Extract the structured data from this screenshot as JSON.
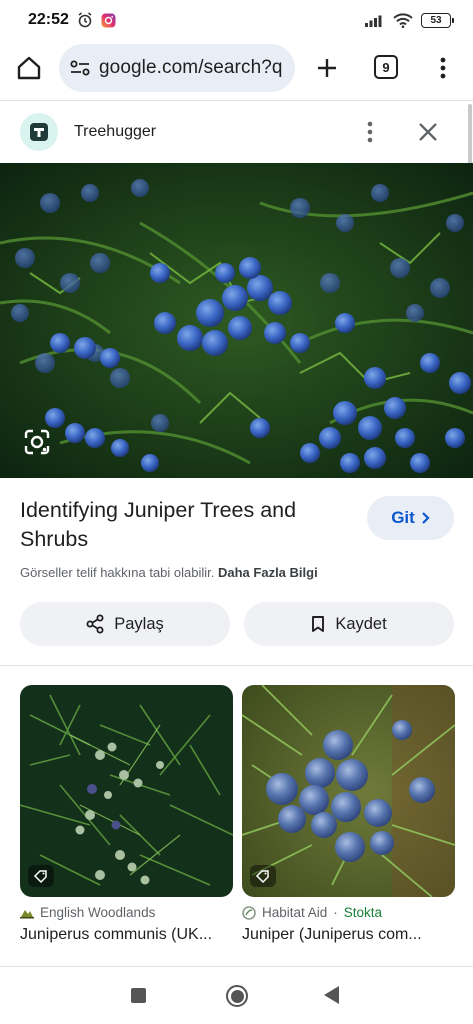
{
  "status_bar": {
    "time": "22:52",
    "battery": "53",
    "icons": [
      "alarm-icon",
      "instagram-icon",
      "signal-icon",
      "wifi-icon",
      "battery-icon"
    ]
  },
  "toolbar": {
    "url": "google.com/search?q",
    "tab_count": "9",
    "icons": [
      "home-icon",
      "site-info-icon",
      "plus-icon",
      "tabs-icon",
      "more-vert-icon"
    ]
  },
  "source": {
    "site_name": "Treehugger"
  },
  "result": {
    "title": "Identifying Juniper Trees and Shrubs",
    "visit_label": "Git",
    "copyright_text": "Görseller telif hakkına tabi olabilir.",
    "learn_more": "Daha Fazla Bilgi",
    "share_label": "Paylaş",
    "save_label": "Kaydet"
  },
  "related": [
    {
      "source": "English Woodlands",
      "stock": "",
      "title": "Juniperus communis (UK..."
    },
    {
      "source": "Habitat Aid",
      "separator": "·",
      "stock": "Stokta",
      "title": "Juniper (Juniperus com..."
    }
  ],
  "colors": {
    "accent_blue": "#0b57d0",
    "chip_bg": "#e9eef6",
    "stock_green": "#188038"
  }
}
